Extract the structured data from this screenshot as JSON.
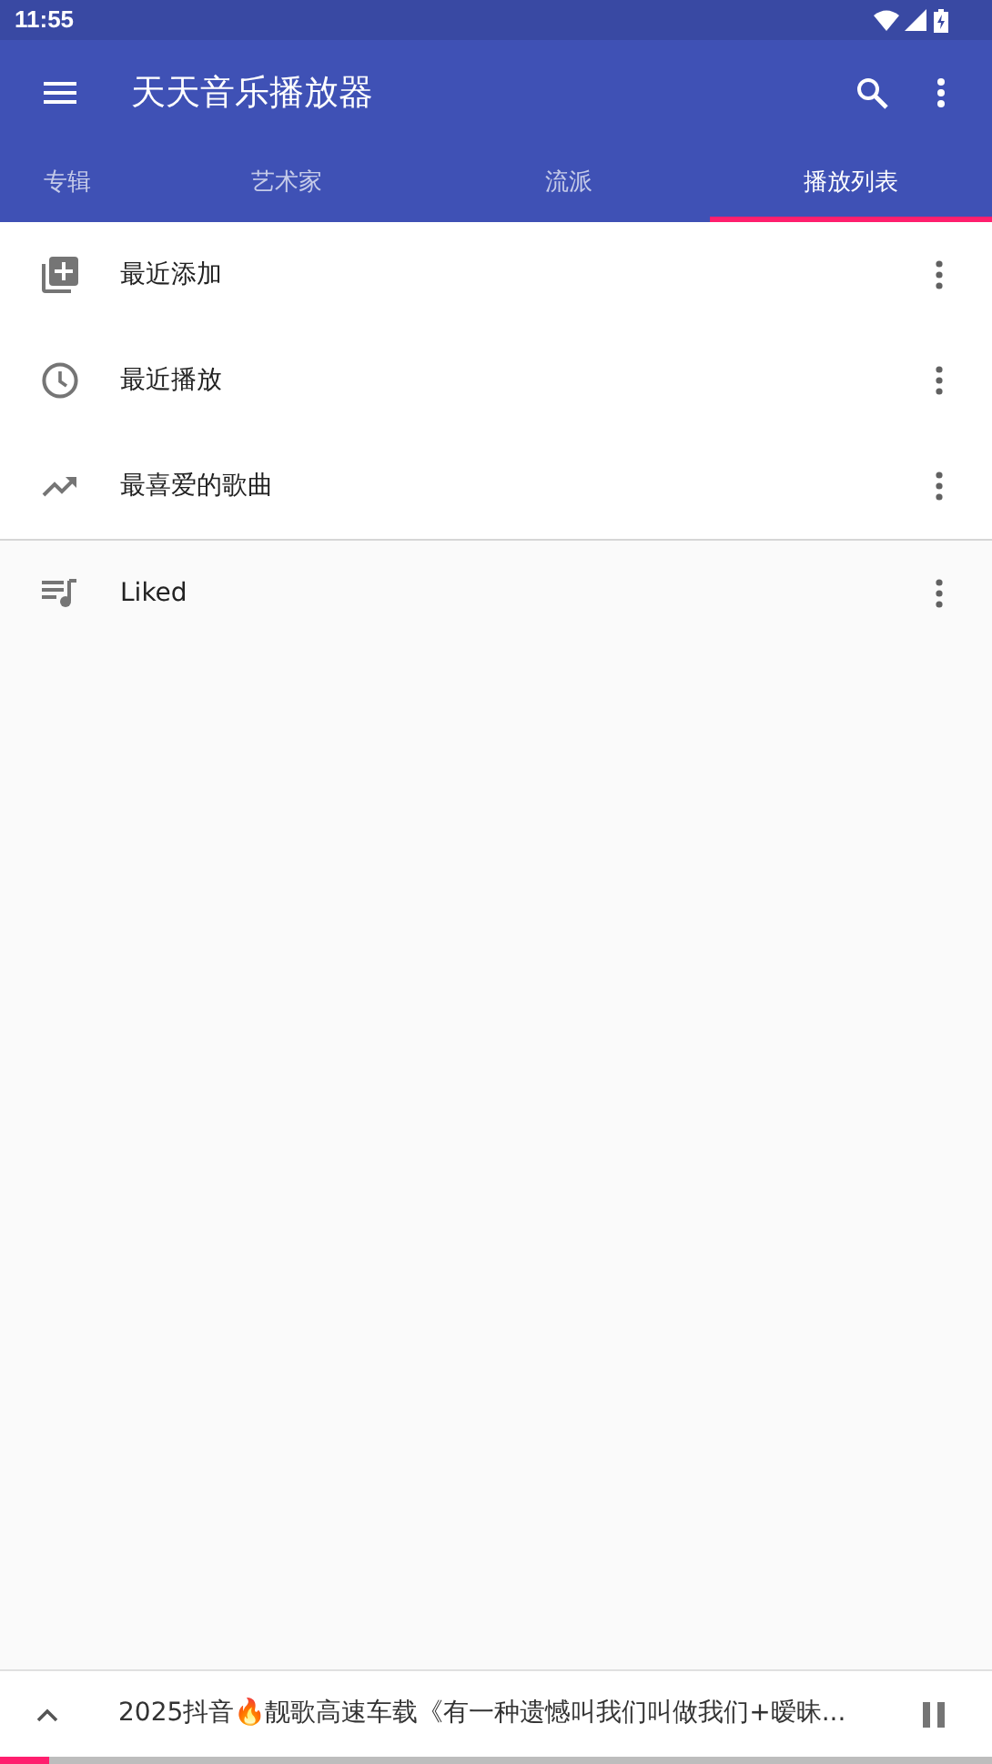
{
  "status_bar": {
    "time": "11:55"
  },
  "toolbar": {
    "title": "天天音乐播放器"
  },
  "tabs": [
    {
      "label": "专辑",
      "selected": false
    },
    {
      "label": "艺术家",
      "selected": false
    },
    {
      "label": "流派",
      "selected": false
    },
    {
      "label": "播放列表",
      "selected": true
    }
  ],
  "smart_playlists": [
    {
      "kind": "added",
      "name": "最近添加"
    },
    {
      "kind": "recent",
      "name": "最近播放"
    },
    {
      "kind": "top",
      "name": "最喜爱的歌曲"
    }
  ],
  "playlists": [
    {
      "kind": "playlist",
      "name": "Liked"
    }
  ],
  "now_playing": {
    "title": "2025抖音🔥靓歌高速车载《有一种遗憾叫我们叫做我们+暧昧...",
    "playing": true,
    "level": 0.05
  }
}
